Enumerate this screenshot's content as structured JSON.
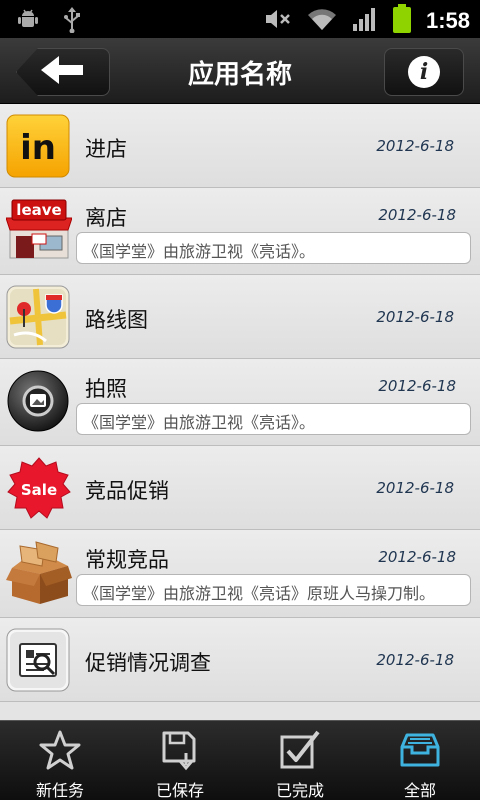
{
  "status_bar": {
    "time": "1:58",
    "icons": [
      "android-debug-icon",
      "usb-icon",
      "mute-icon",
      "wifi-icon",
      "signal-icon",
      "battery-icon"
    ]
  },
  "header": {
    "title": "应用名称",
    "back_icon": "back-arrow-icon",
    "info_icon": "info-icon",
    "info_glyph": "i"
  },
  "list": {
    "items": [
      {
        "name": "进店",
        "date": "2012-6-18",
        "desc": "",
        "icon": "enter-store-icon",
        "icon_text": "in"
      },
      {
        "name": "离店",
        "date": "2012-6-18",
        "desc": "《国学堂》由旅游卫视《亮话》。",
        "icon": "leave-store-icon",
        "icon_text": "leave"
      },
      {
        "name": "路线图",
        "date": "2012-6-18",
        "desc": "",
        "icon": "route-map-icon",
        "icon_text": ""
      },
      {
        "name": "拍照",
        "date": "2012-6-18",
        "desc": "《国学堂》由旅游卫视《亮话》。",
        "icon": "camera-icon",
        "icon_text": ""
      },
      {
        "name": "竞品促销",
        "date": "2012-6-18",
        "desc": "",
        "icon": "sale-icon",
        "icon_text": "Sale"
      },
      {
        "name": "常规竞品",
        "date": "2012-6-18",
        "desc": "《国学堂》由旅游卫视《亮话》原班人马操刀制。",
        "icon": "box-icon",
        "icon_text": ""
      },
      {
        "name": "促销情况调查",
        "date": "2012-6-18",
        "desc": "",
        "icon": "survey-icon",
        "icon_text": ""
      }
    ]
  },
  "tab_bar": {
    "tabs": [
      {
        "label": "新任务",
        "icon": "star-icon",
        "active": false
      },
      {
        "label": "已保存",
        "icon": "save-icon",
        "active": false
      },
      {
        "label": "已完成",
        "icon": "checkbox-icon",
        "active": false
      },
      {
        "label": "全部",
        "icon": "inbox-icon",
        "active": true
      }
    ]
  },
  "colors": {
    "active_tab": "#3fb3e0",
    "inactive_tab": "#d0d0d0",
    "date_text": "#1f3550",
    "list_background": "#e4e4e4"
  }
}
